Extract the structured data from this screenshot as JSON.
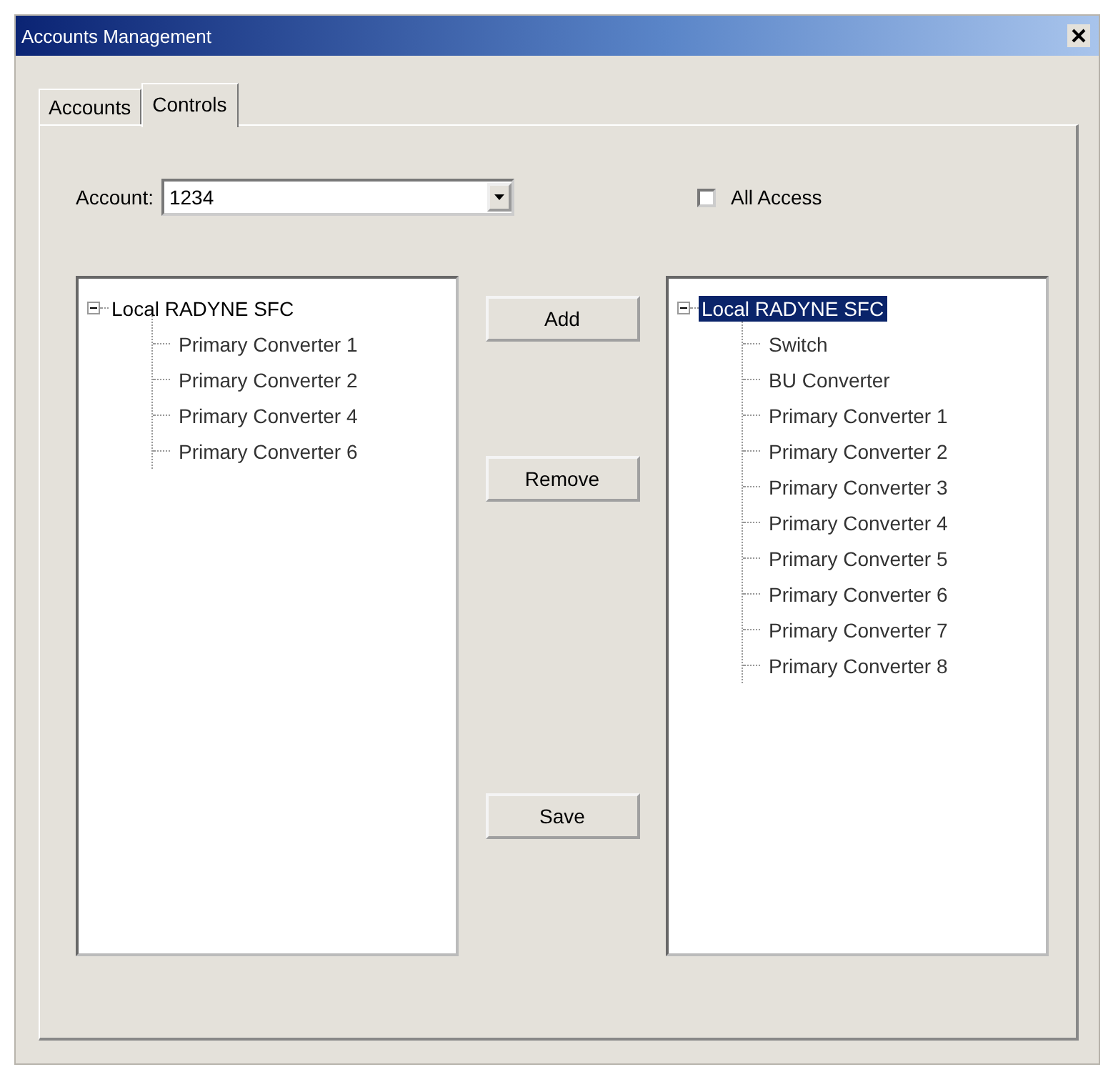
{
  "window": {
    "title": "Accounts Management"
  },
  "tabs": [
    {
      "label": "Accounts",
      "selected": false
    },
    {
      "label": "Controls",
      "selected": true
    }
  ],
  "account": {
    "label": "Account:",
    "value": "1234"
  },
  "all_access": {
    "label": "All Access",
    "checked": false
  },
  "buttons": [
    "Add",
    "Remove",
    "Save"
  ],
  "trees": [
    {
      "nodes": [
        {
          "label": "Local RADYNE SFC",
          "expanded": true,
          "selected": false,
          "children": [
            {
              "label": "Primary Converter 1",
              "selected": false
            },
            {
              "label": "Primary Converter 2",
              "selected": false
            },
            {
              "label": "Primary Converter 4",
              "selected": false
            },
            {
              "label": "Primary Converter 6",
              "selected": false
            }
          ]
        }
      ]
    },
    {
      "nodes": [
        {
          "label": "Local RADYNE SFC",
          "expanded": true,
          "selected": true,
          "children": [
            {
              "label": "Switch",
              "selected": false
            },
            {
              "label": "BU Converter",
              "selected": false
            },
            {
              "label": "Primary Converter 1",
              "selected": false
            },
            {
              "label": "Primary Converter 2",
              "selected": false
            },
            {
              "label": "Primary Converter 3",
              "selected": false
            },
            {
              "label": "Primary Converter 4",
              "selected": false
            },
            {
              "label": "Primary Converter 5",
              "selected": false
            },
            {
              "label": "Primary Converter 6",
              "selected": false
            },
            {
              "label": "Primary Converter 7",
              "selected": false
            },
            {
              "label": "Primary Converter 8",
              "selected": false
            }
          ]
        }
      ]
    }
  ]
}
